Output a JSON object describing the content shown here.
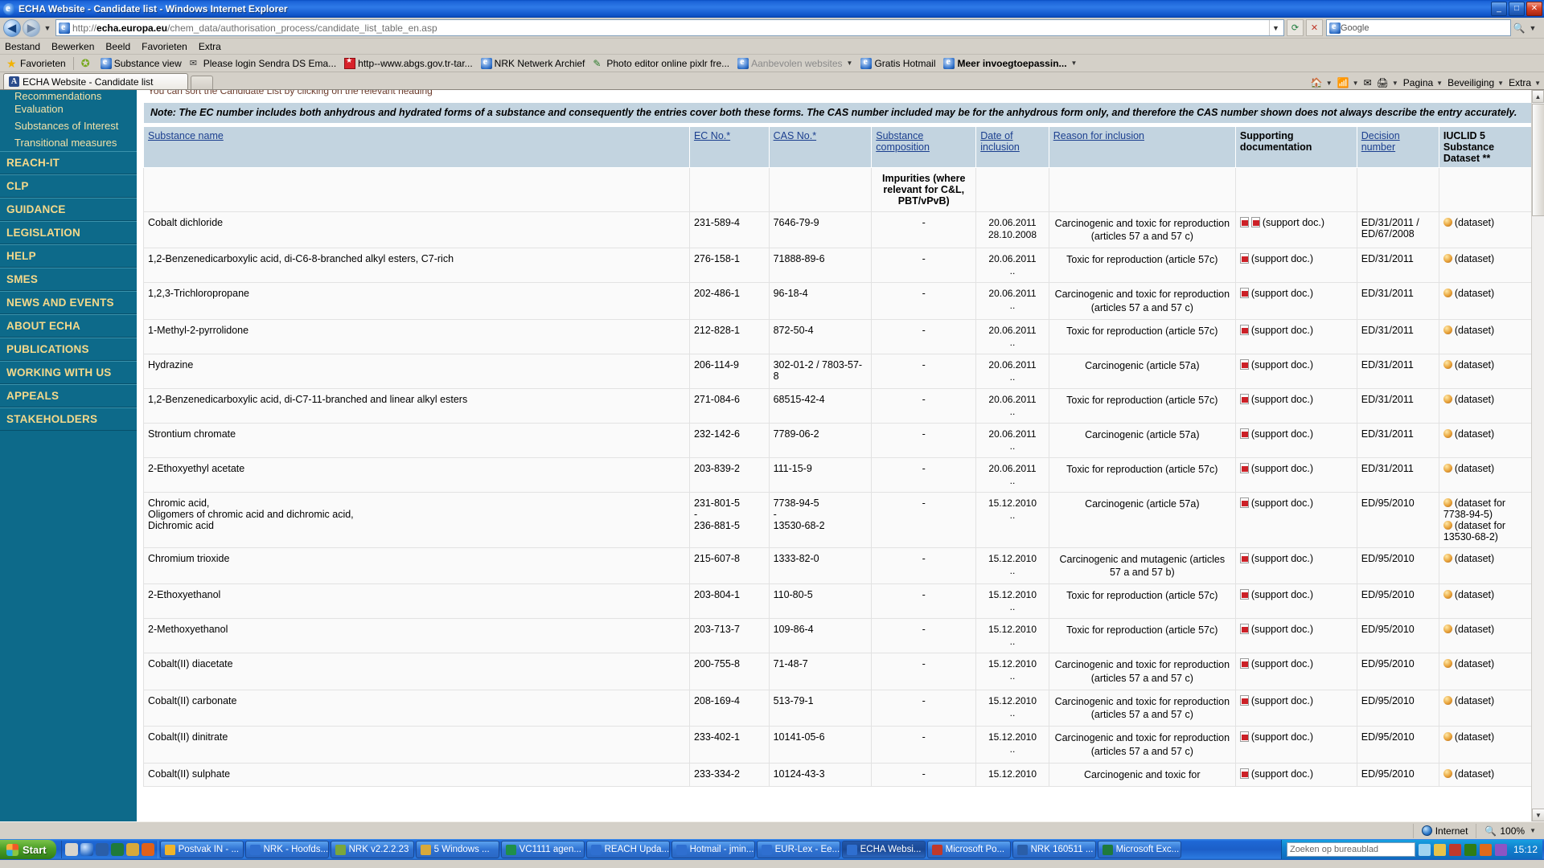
{
  "window": {
    "title": "ECHA Website - Candidate list - Windows Internet Explorer",
    "minimize": "_",
    "maximize": "□",
    "close": "✕"
  },
  "nav": {
    "back": "◀",
    "forward": "▶",
    "history_caret": "▼",
    "url_scheme": "http://",
    "url_host": "echa.europa.eu",
    "url_path": "/chem_data/authorisation_process/candidate_list_table_en.asp",
    "address_caret": "▼",
    "refresh": "⟳",
    "stop": "✕",
    "search_placeholder": "Google",
    "search_value": "Google",
    "search_icon": "🔍"
  },
  "menubar": {
    "items": [
      "Bestand",
      "Bewerken",
      "Beeld",
      "Favorieten",
      "Extra"
    ]
  },
  "favbar": {
    "label": "Favorieten",
    "items": [
      {
        "label": "Substance view",
        "icon": "ie-icon"
      },
      {
        "label": "Please login  Sendra DS Ema...",
        "icon": "mail-icon"
      },
      {
        "label": "http--www.abgs.gov.tr-tar...",
        "icon": "flag-icon"
      },
      {
        "label": "NRK Netwerk Archief",
        "icon": "ie-icon"
      },
      {
        "label": "Photo editor online pixlr fre...",
        "icon": "pen-icon"
      },
      {
        "label": "Aanbevolen websites",
        "icon": "ie-icon",
        "dim": true,
        "caret": "▼"
      },
      {
        "label": "Gratis Hotmail",
        "icon": "ie-icon"
      },
      {
        "label": "Meer invoegtoepassin...",
        "icon": "ie-icon",
        "bold": true,
        "caret": "▼"
      }
    ]
  },
  "tabs": {
    "items": [
      {
        "label": "ECHA Website - Candidate list",
        "icon": "echa-icon",
        "active": true
      }
    ],
    "newtab_tooltip": "",
    "commands": [
      {
        "label": "Pagina",
        "icon": "page-icon",
        "caret": "▼"
      },
      {
        "label": "Beveiliging",
        "icon": "shield-icon",
        "caret": "▼"
      },
      {
        "label": "Extra",
        "icon": "gear-icon",
        "caret": "▼"
      }
    ],
    "command_icons": [
      "home-icon",
      "feed-icon",
      "read-icon",
      "print-icon"
    ]
  },
  "sidebar": {
    "subitems": [
      "Recommendations",
      "Evaluation",
      "Substances of Interest",
      "Transitional measures"
    ],
    "mainitems": [
      "REACH-IT",
      "CLP",
      "GUIDANCE",
      "LEGISLATION",
      "HELP",
      "SMES",
      "NEWS AND EVENTS",
      "ABOUT ECHA",
      "PUBLICATIONS",
      "WORKING WITH US",
      "APPEALS",
      "STAKEHOLDERS"
    ]
  },
  "content": {
    "intro_clipped": "You can sort the Candidate List by clicking on the relevant heading",
    "note": "Note: The EC number includes both anhydrous and hydrated forms of a substance and consequently the entries cover both these forms. The CAS number included may be for the anhydrous form only, and therefore the CAS number shown does not always describe the entry accurately."
  },
  "table": {
    "headers": [
      {
        "label": "Substance name",
        "link": true
      },
      {
        "label": "EC No.*",
        "link": true
      },
      {
        "label": "CAS No.*",
        "link": true
      },
      {
        "label": "Substance composition",
        "link": true
      },
      {
        "label": "Date of inclusion",
        "link": true
      },
      {
        "label": "Reason for inclusion",
        "link": true
      },
      {
        "label": "Supporting documentation",
        "link": false
      },
      {
        "label": "Decision number",
        "link": true
      },
      {
        "label": "IUCLID 5 Substance Dataset **",
        "link": false
      }
    ],
    "subheader": {
      "substance_composition": "Impurities (where relevant for C&L, PBT/vPvB)"
    },
    "support_doc_label": "(support doc.)",
    "dataset_label": "(dataset)",
    "rows": [
      {
        "name": "Cobalt dichloride",
        "ec": "231-589-4",
        "cas": "7646-79-9",
        "composition": "-",
        "date": "20.06.2011\n28.10.2008",
        "reason": "Carcinogenic and toxic for reproduction (articles 57 a and 57 c)",
        "support_docs": 2,
        "decision": "ED/31/2011 / ED/67/2008",
        "datasets": [
          "(dataset)"
        ]
      },
      {
        "name": "1,2-Benzenedicarboxylic acid, di-C6-8-branched alkyl esters, C7-rich",
        "ec": "276-158-1",
        "cas": "71888-89-6",
        "composition": "-",
        "date": "20.06.2011\n..",
        "reason": "Toxic for reproduction (article 57c)",
        "support_docs": 1,
        "decision": "ED/31/2011",
        "datasets": [
          "(dataset)"
        ]
      },
      {
        "name": "1,2,3-Trichloropropane",
        "ec": "202-486-1",
        "cas": "96-18-4",
        "composition": "-",
        "date": "20.06.2011\n..",
        "reason": "Carcinogenic and toxic for reproduction (articles 57 a and 57 c)",
        "support_docs": 1,
        "decision": "ED/31/2011",
        "datasets": [
          "(dataset)"
        ]
      },
      {
        "name": "1-Methyl-2-pyrrolidone",
        "ec": "212-828-1",
        "cas": "872-50-4",
        "composition": "-",
        "date": "20.06.2011\n..",
        "reason": "Toxic for reproduction (article 57c)",
        "support_docs": 1,
        "decision": "ED/31/2011",
        "datasets": [
          "(dataset)"
        ]
      },
      {
        "name": "Hydrazine",
        "ec": "206-114-9",
        "cas": "302-01-2 / 7803-57-8",
        "composition": "-",
        "date": "20.06.2011\n..",
        "reason": "Carcinogenic (article 57a)",
        "support_docs": 1,
        "decision": "ED/31/2011",
        "datasets": [
          "(dataset)"
        ]
      },
      {
        "name": "1,2-Benzenedicarboxylic acid, di-C7-11-branched and linear alkyl esters",
        "ec": "271-084-6",
        "cas": "68515-42-4",
        "composition": "-",
        "date": "20.06.2011\n..",
        "reason": "Toxic for reproduction (article 57c)",
        "support_docs": 1,
        "decision": "ED/31/2011",
        "datasets": [
          "(dataset)"
        ]
      },
      {
        "name": "Strontium chromate",
        "ec": "232-142-6",
        "cas": "7789-06-2",
        "composition": "-",
        "date": "20.06.2011\n..",
        "reason": "Carcinogenic (article 57a)",
        "support_docs": 1,
        "decision": "ED/31/2011",
        "datasets": [
          "(dataset)"
        ]
      },
      {
        "name": "2-Ethoxyethyl acetate",
        "ec": "203-839-2",
        "cas": "111-15-9",
        "composition": "-",
        "date": "20.06.2011\n..",
        "reason": "Toxic for reproduction (article 57c)",
        "support_docs": 1,
        "decision": "ED/31/2011",
        "datasets": [
          "(dataset)"
        ]
      },
      {
        "name": "Chromic acid,\nOligomers of chromic acid and dichromic acid,\nDichromic acid",
        "ec": "231-801-5\n-\n236-881-5",
        "cas": "7738-94-5\n-\n13530-68-2",
        "composition": "-",
        "date": "15.12.2010\n..",
        "reason": "Carcinogenic (article 57a)",
        "support_docs": 1,
        "decision": "ED/95/2010",
        "datasets": [
          "(dataset for 7738-94-5)",
          "(dataset for 13530-68-2)"
        ]
      },
      {
        "name": "Chromium trioxide",
        "ec": "215-607-8",
        "cas": "1333-82-0",
        "composition": "-",
        "date": "15.12.2010\n..",
        "reason": "Carcinogenic and mutagenic (articles 57 a and 57 b)",
        "support_docs": 1,
        "decision": "ED/95/2010",
        "datasets": [
          "(dataset)"
        ]
      },
      {
        "name": "2-Ethoxyethanol",
        "ec": "203-804-1",
        "cas": "110-80-5",
        "composition": "-",
        "date": "15.12.2010\n..",
        "reason": "Toxic for reproduction (article 57c)",
        "support_docs": 1,
        "decision": "ED/95/2010",
        "datasets": [
          "(dataset)"
        ]
      },
      {
        "name": "2-Methoxyethanol",
        "ec": "203-713-7",
        "cas": "109-86-4",
        "composition": "-",
        "date": "15.12.2010\n..",
        "reason": "Toxic for reproduction (article 57c)",
        "support_docs": 1,
        "decision": "ED/95/2010",
        "datasets": [
          "(dataset)"
        ]
      },
      {
        "name": "Cobalt(II) diacetate",
        "ec": "200-755-8",
        "cas": "71-48-7",
        "composition": "-",
        "date": "15.12.2010\n..",
        "reason": "Carcinogenic and toxic for reproduction (articles 57 a and 57 c)",
        "support_docs": 1,
        "decision": "ED/95/2010",
        "datasets": [
          "(dataset)"
        ]
      },
      {
        "name": "Cobalt(II) carbonate",
        "ec": "208-169-4",
        "cas": "513-79-1",
        "composition": "-",
        "date": "15.12.2010\n..",
        "reason": "Carcinogenic and toxic for reproduction (articles 57 a and 57 c)",
        "support_docs": 1,
        "decision": "ED/95/2010",
        "datasets": [
          "(dataset)"
        ]
      },
      {
        "name": "Cobalt(II) dinitrate",
        "ec": "233-402-1",
        "cas": "10141-05-6",
        "composition": "-",
        "date": "15.12.2010\n..",
        "reason": "Carcinogenic and toxic for reproduction (articles 57 a and 57 c)",
        "support_docs": 1,
        "decision": "ED/95/2010",
        "datasets": [
          "(dataset)"
        ]
      },
      {
        "name": "Cobalt(II) sulphate",
        "ec": "233-334-2",
        "cas": "10124-43-3",
        "composition": "-",
        "date": "15.12.2010",
        "reason": "Carcinogenic and toxic for",
        "support_docs": 1,
        "decision": "ED/95/2010",
        "datasets": [
          "(dataset)"
        ]
      }
    ]
  },
  "statusbar": {
    "left": "",
    "zone": "Internet",
    "zoom": "100%",
    "zoom_caret": "▼"
  },
  "taskbar": {
    "start": "Start",
    "items": [
      {
        "label": "Postvak IN - ...",
        "color": "#f0b429"
      },
      {
        "label": "NRK - Hoofds...",
        "color": "#2f6fd0"
      },
      {
        "label": "NRK v2.2.2.23",
        "color": "#7aa63c"
      },
      {
        "label": "5 Windows ...",
        "color": "#d8a93a"
      },
      {
        "label": "VC1111 agen...",
        "color": "#1f8f4a"
      },
      {
        "label": "REACH Upda...",
        "color": "#2f6fd0"
      },
      {
        "label": "Hotmail - jmin...",
        "color": "#2f6fd0"
      },
      {
        "label": "EUR-Lex - Ee...",
        "color": "#2f6fd0"
      },
      {
        "label": "ECHA Websi...",
        "color": "#2f6fd0",
        "active": true
      },
      {
        "label": "Microsoft Po...",
        "color": "#c0392b"
      },
      {
        "label": "NRK 160511 ...",
        "color": "#2a5ea8"
      },
      {
        "label": "Microsoft Exc...",
        "color": "#1f7a3c"
      }
    ],
    "tray_search_placeholder": "Zoeken op bureaublad",
    "clock": "15:12"
  }
}
